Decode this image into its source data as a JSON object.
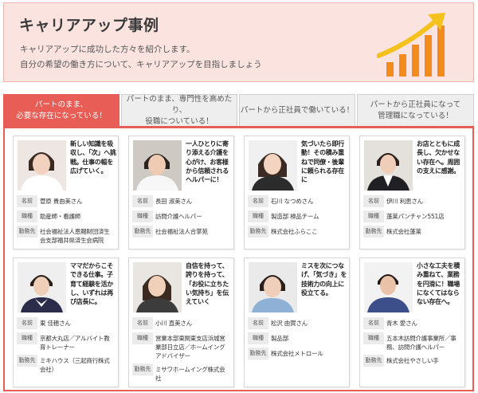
{
  "header": {
    "title": "キャリアアップ事例",
    "line1": "キャリアアップに成功した方々を紹介します。",
    "line2": "自分の希望の働き方について、キャリアアップを目指しましょう",
    "icon": "growth-chart-icon",
    "accent": "#f28a1e"
  },
  "tabs": [
    {
      "label": "パートのまま、\n必要な存在になっている！"
    },
    {
      "label": "パートのまま、専門性を高めたり、\n役職についている！"
    },
    {
      "label": "パートから正社員で働いている！"
    },
    {
      "label": "パートから正社員になって\n管理職になっている！"
    }
  ],
  "labels": {
    "name": "名前",
    "job": "職種",
    "office": "勤務先"
  },
  "cards": [
    {
      "quote": "新しい知識を吸収し、「次」へ挑戦。仕事の幅を広げていく。",
      "name": "菅原 貴由美さん",
      "job": "助産師・看護師",
      "office": "社会福祉法人恩賜財団済生会支部福井県済生会病院"
    },
    {
      "quote": "一人ひとりに寄り添える介護を心がけ、お客様から信頼されるヘルパーに！",
      "name": "長田 淑美さん",
      "job": "訪問介護ヘルパー",
      "office": "社会福祉法人合掌苑"
    },
    {
      "quote": "気づいたら即行動！その積み重ねで同僚・後輩に頼られる存在に",
      "name": "石川 なつめさん",
      "job": "製造部 検品チーム",
      "office": "株式会社ふらここ"
    },
    {
      "quote": "お店とともに成長し、欠かせない存在へ。周囲の支えに感謝。",
      "name": "伊川 利恵さん",
      "job": "蓬莱パンチャン551店",
      "office": "株式会社蓬莱"
    },
    {
      "quote": "ママだからこそできる仕事。子育て経験を活かし、いずれは再び店長に。",
      "name": "東 佳穂さん",
      "job": "京都大丸店／アルバイト教育トレーナー",
      "office": "ミキハウス（三起商行株式会社）"
    },
    {
      "quote": "自信を持って、誇りを持って、「お役に立ちたい気持ち」を伝えていく",
      "name": "小川 直美さん",
      "job": "営業本部東関東支店浜城営業部日立店／ホームイングアドバイザー",
      "office": "ミサワホームイング株式会社"
    },
    {
      "quote": "ミスを次につなげ、「気づき」を技術力の向上に役立てる。",
      "name": "松沢 由賀さん",
      "job": "製品部",
      "office": "株式会社メトロール"
    },
    {
      "quote": "小さな工夫を積み重ねて、業務を円滑に！職場になくてはならない存在へ。",
      "name": "青木 愛さん",
      "job": "五本木訪問介護事業所／事務、訪問介護ヘルパー",
      "office": "株式会社やさしい手"
    }
  ]
}
